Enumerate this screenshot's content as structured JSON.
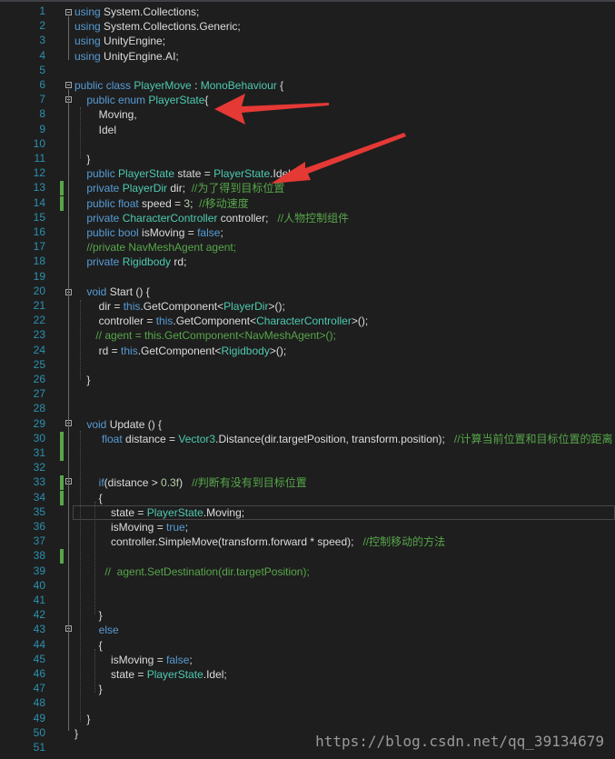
{
  "line_numbers": [
    "1",
    "2",
    "3",
    "4",
    "5",
    "6",
    "7",
    "8",
    "9",
    "10",
    "11",
    "12",
    "13",
    "14",
    "15",
    "16",
    "17",
    "18",
    "19",
    "20",
    "21",
    "22",
    "23",
    "24",
    "25",
    "26",
    "27",
    "28",
    "29",
    "30",
    "31",
    "32",
    "33",
    "34",
    "35",
    "36",
    "37",
    "38",
    "39",
    "40",
    "41",
    "42",
    "43",
    "44",
    "45",
    "46",
    "47",
    "48",
    "49",
    "50",
    "51"
  ],
  "lines": [
    [
      {
        "t": "using",
        "c": "kw"
      },
      {
        "t": " System.Collections;",
        "c": "pl"
      }
    ],
    [
      {
        "t": "using",
        "c": "kw"
      },
      {
        "t": " System.Collections.Generic;",
        "c": "pl"
      }
    ],
    [
      {
        "t": "using",
        "c": "kw"
      },
      {
        "t": " UnityEngine;",
        "c": "pl"
      }
    ],
    [
      {
        "t": "using",
        "c": "kw"
      },
      {
        "t": " UnityEngine.AI;",
        "c": "pl"
      }
    ],
    [],
    [
      {
        "t": "public class ",
        "c": "kw"
      },
      {
        "t": "PlayerMove",
        "c": "ty"
      },
      {
        "t": " : ",
        "c": "pl"
      },
      {
        "t": "MonoBehaviour",
        "c": "ty"
      },
      {
        "t": " {",
        "c": "pl"
      }
    ],
    [
      {
        "t": "    public enum ",
        "c": "kw"
      },
      {
        "t": "PlayerState",
        "c": "ty"
      },
      {
        "t": "{",
        "c": "pl"
      }
    ],
    [
      {
        "t": "        Moving,",
        "c": "pl"
      }
    ],
    [
      {
        "t": "        Idel",
        "c": "pl"
      }
    ],
    [],
    [
      {
        "t": "    }",
        "c": "pl"
      }
    ],
    [
      {
        "t": "    public ",
        "c": "kw"
      },
      {
        "t": "PlayerState",
        "c": "ty"
      },
      {
        "t": " state = ",
        "c": "pl"
      },
      {
        "t": "PlayerState",
        "c": "ty"
      },
      {
        "t": ".Idel;",
        "c": "pl"
      }
    ],
    [
      {
        "t": "    private ",
        "c": "kw"
      },
      {
        "t": "PlayerDir",
        "c": "ty"
      },
      {
        "t": " dir;  ",
        "c": "pl"
      },
      {
        "t": "//为了得到目标位置",
        "c": "cm"
      }
    ],
    [
      {
        "t": "    public float ",
        "c": "kw"
      },
      {
        "t": "speed = ",
        "c": "pl"
      },
      {
        "t": "3",
        "c": "num"
      },
      {
        "t": ";  ",
        "c": "pl"
      },
      {
        "t": "//移动速度",
        "c": "cm"
      }
    ],
    [
      {
        "t": "    private ",
        "c": "kw"
      },
      {
        "t": "CharacterController",
        "c": "ty"
      },
      {
        "t": " controller;   ",
        "c": "pl"
      },
      {
        "t": "//人物控制组件",
        "c": "cm"
      }
    ],
    [
      {
        "t": "    public bool ",
        "c": "kw"
      },
      {
        "t": "isMoving = ",
        "c": "pl"
      },
      {
        "t": "false",
        "c": "kw"
      },
      {
        "t": ";",
        "c": "pl"
      }
    ],
    [
      {
        "t": "    //private NavMeshAgent agent;",
        "c": "cm"
      }
    ],
    [
      {
        "t": "    private ",
        "c": "kw"
      },
      {
        "t": "Rigidbody",
        "c": "ty"
      },
      {
        "t": " rd;",
        "c": "pl"
      }
    ],
    [],
    [
      {
        "t": "    void ",
        "c": "kw"
      },
      {
        "t": "Start () {",
        "c": "pl"
      }
    ],
    [
      {
        "t": "        dir = ",
        "c": "pl"
      },
      {
        "t": "this",
        "c": "kw"
      },
      {
        "t": ".GetComponent<",
        "c": "pl"
      },
      {
        "t": "PlayerDir",
        "c": "ty"
      },
      {
        "t": ">();",
        "c": "pl"
      }
    ],
    [
      {
        "t": "        controller = ",
        "c": "pl"
      },
      {
        "t": "this",
        "c": "kw"
      },
      {
        "t": ".GetComponent<",
        "c": "pl"
      },
      {
        "t": "CharacterController",
        "c": "ty"
      },
      {
        "t": ">();",
        "c": "pl"
      }
    ],
    [
      {
        "t": "       // agent = this.GetComponent<NavMeshAgent>();",
        "c": "cm"
      }
    ],
    [
      {
        "t": "        rd = ",
        "c": "pl"
      },
      {
        "t": "this",
        "c": "kw"
      },
      {
        "t": ".GetComponent<",
        "c": "pl"
      },
      {
        "t": "Rigidbody",
        "c": "ty"
      },
      {
        "t": ">();",
        "c": "pl"
      }
    ],
    [],
    [
      {
        "t": "    }",
        "c": "pl"
      }
    ],
    [],
    [],
    [
      {
        "t": "    void ",
        "c": "kw"
      },
      {
        "t": "Update () {",
        "c": "pl"
      }
    ],
    [
      {
        "t": "         float ",
        "c": "kw"
      },
      {
        "t": "distance = ",
        "c": "pl"
      },
      {
        "t": "Vector3",
        "c": "ty"
      },
      {
        "t": ".Distance(dir.targetPosition, transform.position);   ",
        "c": "pl"
      },
      {
        "t": "//计算当前位置和目标位置的距离",
        "c": "cm"
      }
    ],
    [],
    [],
    [
      {
        "t": "        if",
        "c": "kw"
      },
      {
        "t": "(distance > ",
        "c": "pl"
      },
      {
        "t": "0.3f",
        "c": "num"
      },
      {
        "t": ")   ",
        "c": "pl"
      },
      {
        "t": "//判断有没有到目标位置",
        "c": "cm"
      }
    ],
    [
      {
        "t": "        {",
        "c": "pl"
      }
    ],
    [
      {
        "t": "            state = ",
        "c": "pl"
      },
      {
        "t": "PlayerState",
        "c": "ty"
      },
      {
        "t": ".Moving;",
        "c": "pl"
      }
    ],
    [
      {
        "t": "            isMoving = ",
        "c": "pl"
      },
      {
        "t": "true",
        "c": "kw"
      },
      {
        "t": ";",
        "c": "pl"
      }
    ],
    [
      {
        "t": "            controller.SimpleMove(transform.forward * speed);   ",
        "c": "pl"
      },
      {
        "t": "//控制移动的方法",
        "c": "cm"
      }
    ],
    [],
    [
      {
        "t": "          //  agent.SetDestination(dir.targetPosition);",
        "c": "cm"
      }
    ],
    [],
    [],
    [
      {
        "t": "        }",
        "c": "pl"
      }
    ],
    [
      {
        "t": "        else",
        "c": "kw"
      }
    ],
    [
      {
        "t": "        {",
        "c": "pl"
      }
    ],
    [
      {
        "t": "            isMoving = ",
        "c": "pl"
      },
      {
        "t": "false",
        "c": "kw"
      },
      {
        "t": ";",
        "c": "pl"
      }
    ],
    [
      {
        "t": "            state = ",
        "c": "pl"
      },
      {
        "t": "PlayerState",
        "c": "ty"
      },
      {
        "t": ".Idel;",
        "c": "pl"
      }
    ],
    [
      {
        "t": "        }",
        "c": "pl"
      }
    ],
    [],
    [
      {
        "t": "    }",
        "c": "pl"
      }
    ],
    [
      {
        "t": "}",
        "c": "pl"
      }
    ],
    []
  ],
  "changed_lines": [
    13,
    14,
    30,
    31,
    33,
    34,
    38
  ],
  "current_line": 35,
  "colors": {
    "background": "#1e1e1e",
    "line_number": "#2b91af",
    "keyword": "#569cd6",
    "type": "#4ec9b0",
    "comment": "#57a64a",
    "number": "#b5cea8",
    "text": "#dcdcdc",
    "change_bar": "#57a64a",
    "annotation_arrow": "#e53935"
  },
  "annotations": [
    "red-arrow-to-enum-declaration",
    "red-arrow-to-state-field"
  ],
  "watermark": "https://blog.csdn.net/qq_39134679"
}
